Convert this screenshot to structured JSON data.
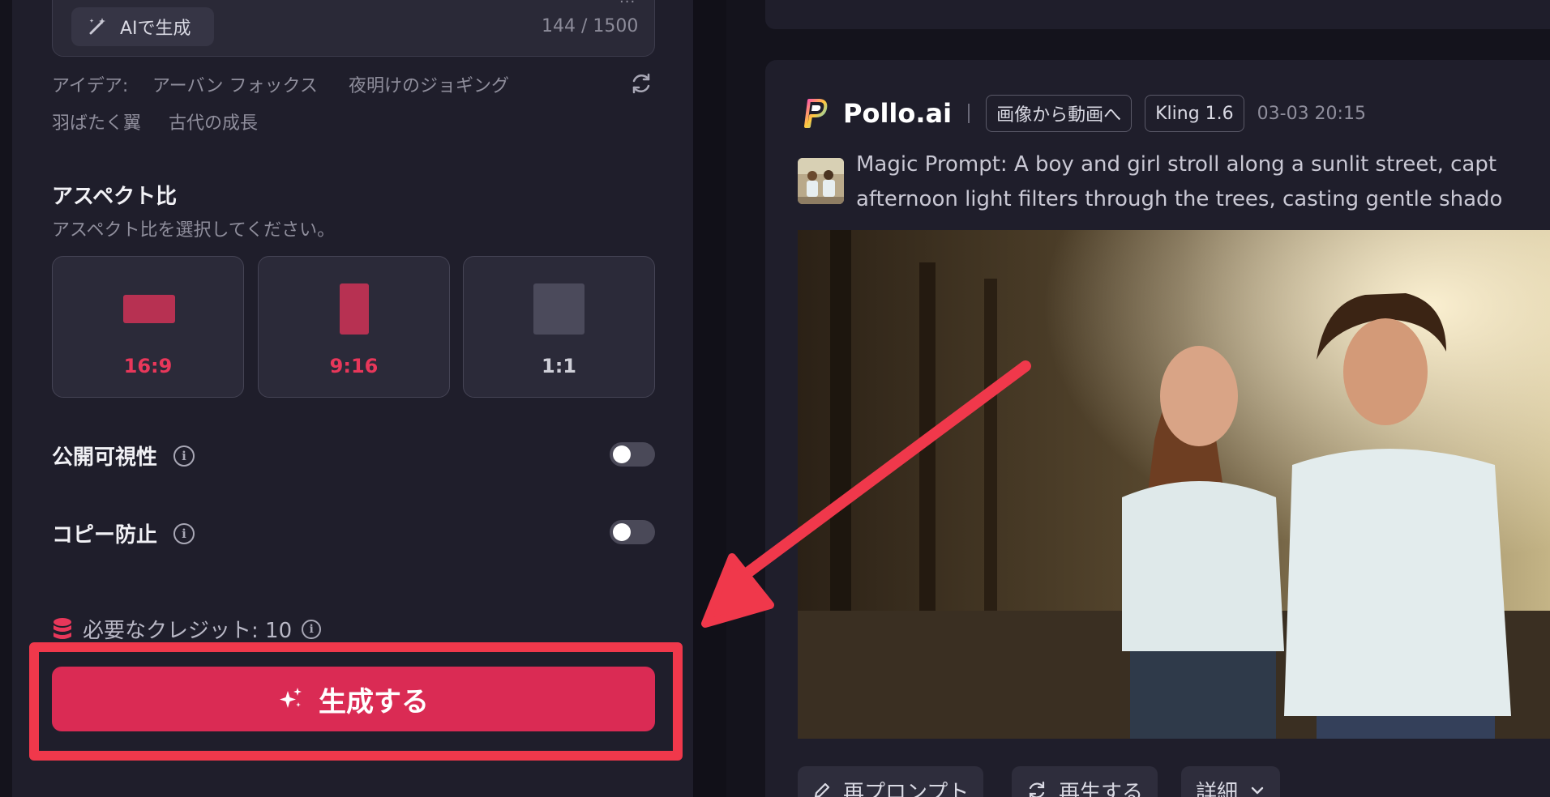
{
  "prompt_box": {
    "ai_button_label": "AIで生成",
    "char_count": "144 / 1500"
  },
  "ideas": {
    "label": "アイデア:",
    "chips": [
      "アーバン フォックス",
      "夜明けのジョギング",
      "羽ばたく翼",
      "古代の成長"
    ]
  },
  "aspect": {
    "title": "アスペクト比",
    "subtitle": "アスペクト比を選択してください。",
    "options": [
      {
        "label": "16:9",
        "color": "#e8375a"
      },
      {
        "label": "9:16",
        "color": "#e8375a"
      },
      {
        "label": "1:1",
        "color": "#cfcfd8"
      }
    ]
  },
  "toggles": {
    "public_visibility": "公開可視性",
    "copy_protection": "コピー防止"
  },
  "credits": {
    "text": "必要なクレジット: 10"
  },
  "generate_button": "生成する",
  "result": {
    "brand": "Pollo.ai",
    "tags": [
      "画像から動画へ",
      "Kling 1.6"
    ],
    "timestamp": "03-03 20:15",
    "magic_prompt_line1": "Magic Prompt: A boy and girl stroll along a sunlit street, capt",
    "magic_prompt_line2": "afternoon light filters through the trees, casting gentle shado",
    "actions": [
      "再プロンプト",
      "再生する",
      "詳細"
    ]
  },
  "colors": {
    "accent": "#da2b54",
    "highlight": "#f0384b"
  }
}
